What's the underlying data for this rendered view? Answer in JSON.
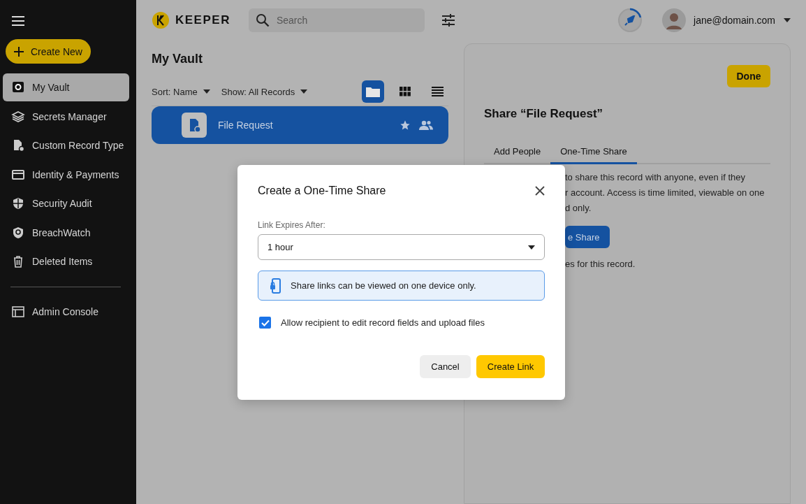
{
  "sidebar": {
    "create_button": "Create New",
    "items": [
      {
        "label": "My Vault",
        "selected": true
      },
      {
        "label": "Secrets Manager",
        "selected": false
      },
      {
        "label": "Custom Record Type",
        "selected": false
      },
      {
        "label": "Identity & Payments",
        "selected": false
      },
      {
        "label": "Security Audit",
        "selected": false
      },
      {
        "label": "BreachWatch",
        "selected": false
      },
      {
        "label": "Deleted Items",
        "selected": false
      }
    ],
    "footer_items": [
      {
        "label": "Admin Console",
        "selected": false
      }
    ]
  },
  "header": {
    "logo": "KEEPER",
    "search": {
      "placeholder": "Search"
    },
    "user": "jane@domain.com"
  },
  "vault": {
    "title": "My Vault",
    "sort": "Sort: Name",
    "show": "Show: All Records",
    "views": [
      {
        "kind": "folder",
        "selected": true
      },
      {
        "kind": "grid",
        "selected": false
      },
      {
        "kind": "list",
        "selected": false
      }
    ],
    "records": [
      {
        "title": "File Request",
        "selected": true
      }
    ]
  },
  "share_panel": {
    "done": "Done",
    "title": "Share “File Request”",
    "tabs": [
      {
        "label": "Add People",
        "selected": false
      },
      {
        "label": "One-Time Share",
        "selected": true
      }
    ],
    "description_lines": [
      "to share this record with anyone, even if they",
      "r account. Access is time limited, viewable on one",
      "d only."
    ],
    "button": "e Share",
    "footer": "es for this record."
  },
  "dialog": {
    "title": "Create a One-Time Share",
    "field_label": "Link Expires After:",
    "select_value": "1 hour",
    "info": "Share links can be viewed on one device only.",
    "checkbox": {
      "label": "Allow recipient to edit record fields and upload files",
      "checked": true
    },
    "buttons": [
      {
        "label": "Cancel",
        "kind": "secondary"
      },
      {
        "label": "Create Link",
        "kind": "primary"
      }
    ]
  }
}
